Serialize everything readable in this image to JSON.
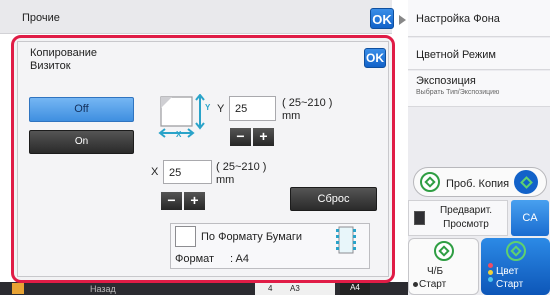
{
  "header": {
    "title": "Прочие",
    "ok_label": "OK"
  },
  "dialog": {
    "title_line1": "Копирование",
    "title_line2": "Визиток",
    "ok_label": "OK",
    "options": [
      {
        "label": "Off",
        "selected": true
      },
      {
        "label": "On",
        "selected": false
      }
    ],
    "y_label": "Y",
    "y_value": "25",
    "y_range": "( 25~210 )",
    "y_unit": "mm",
    "x_label": "X",
    "x_value": "25",
    "x_range": "( 25~210 )",
    "x_unit": "mm",
    "minus": "−",
    "plus": "+",
    "reset_label": "Сброс",
    "paper_checkbox_label": "По Формату Бумаги",
    "format_label": "Формат",
    "format_value": ":  A4"
  },
  "right_menu": {
    "items": [
      {
        "label": "Настройка Фона"
      },
      {
        "label": "Цветной Режим"
      },
      {
        "label": "Экспозиция",
        "sub": "Выбрать Тип/Экспозицию"
      }
    ],
    "proof_copy_label": "Проб. Копия",
    "preview_line1": "Предварит.",
    "preview_line2": "Просмотр",
    "ca_label": "CA",
    "start_bw_line1": "Ч/Б",
    "start_bw_line2": "Старт",
    "start_color_line1": "Цвет",
    "start_color_line2": "Старт"
  },
  "bottom_bar": {
    "back_label": "Назад",
    "tray1": "4",
    "size1": "A3",
    "size2": "A4"
  },
  "colors": {
    "accent_red": "#e01c46",
    "ok_blue": "#1262c9",
    "ca_blue": "#2c86e0",
    "selected_blue": "#5aa6ee"
  }
}
